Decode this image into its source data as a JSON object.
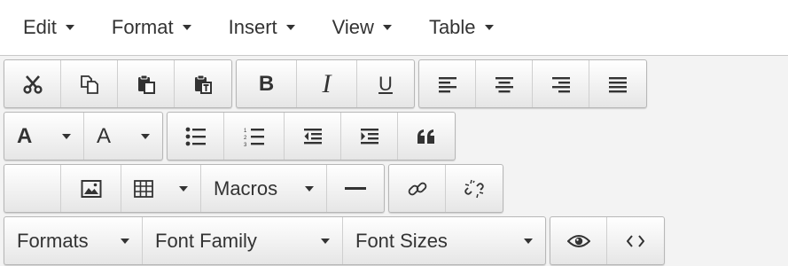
{
  "menubar": {
    "items": [
      {
        "label": "Edit"
      },
      {
        "label": "Format"
      },
      {
        "label": "Insert"
      },
      {
        "label": "View"
      },
      {
        "label": "Table"
      }
    ]
  },
  "toolbar": {
    "bold_label": "B",
    "italic_label": "I",
    "underline_label": "U",
    "font_color_label": "A",
    "bg_color_label": "A",
    "quote_label": "66",
    "macros_label": "Macros",
    "formats_label": "Formats",
    "font_family_label": "Font Family",
    "font_sizes_label": "Font Sizes"
  },
  "icons": {
    "cut": "scissors-icon",
    "copy": "copy-icon",
    "paste": "paste-icon",
    "paste_text": "paste-text-icon",
    "image": "image-icon",
    "table": "table-icon",
    "hr": "horizontal-rule-icon",
    "link": "link-icon",
    "unlink": "unlink-icon",
    "preview": "eye-icon",
    "code": "code-icon"
  }
}
